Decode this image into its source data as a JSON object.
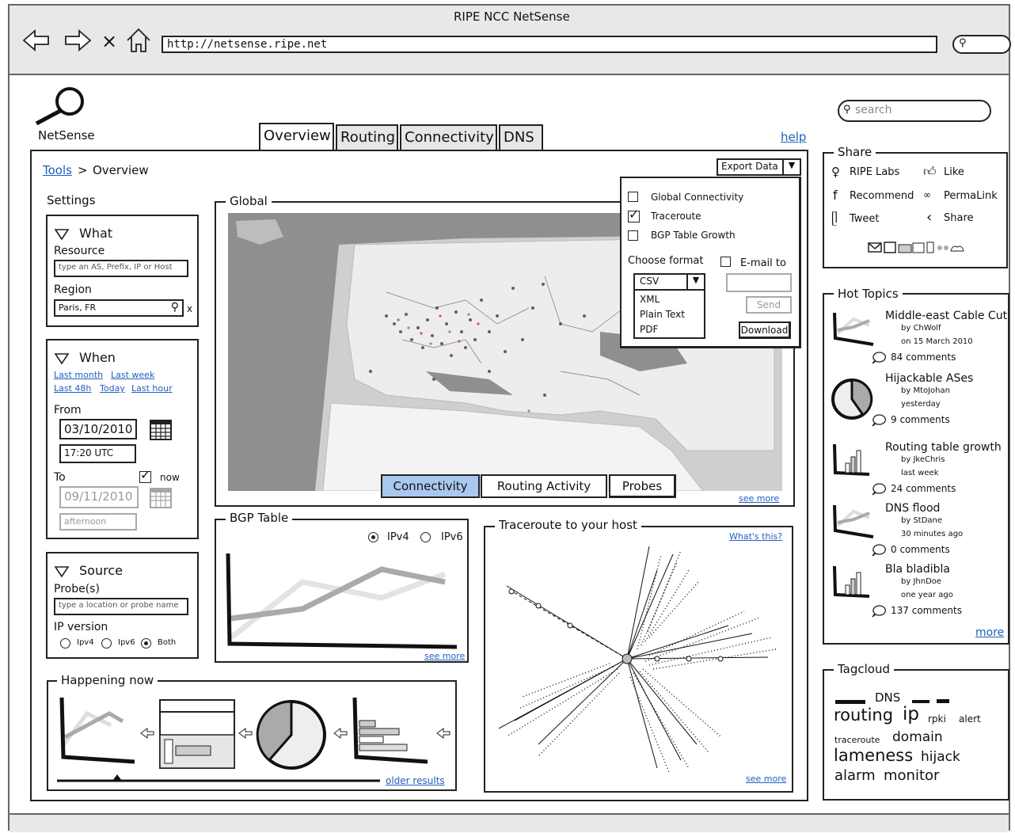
{
  "window": {
    "title": "RIPE NCC NetSense",
    "url": "http://netsense.ripe.net"
  },
  "logo": {
    "text": "NetSense"
  },
  "tabs": [
    "Overview",
    "Routing",
    "Connectivity",
    "DNS"
  ],
  "help_label": "help",
  "search": {
    "placeholder": "search"
  },
  "breadcrumb": {
    "tools": "Tools",
    "sep": ">",
    "current": "Overview"
  },
  "settings": {
    "title": "Settings",
    "what": {
      "title": "What",
      "resource_label": "Resource",
      "resource_placeholder": "type an AS, Prefix, IP or Host",
      "region_label": "Region",
      "region_value": "Paris, FR",
      "clear": "x"
    },
    "when": {
      "title": "When",
      "quick_links": [
        "Last month",
        "Last week",
        "Last 48h",
        "Today",
        "Last hour"
      ],
      "from_label": "From",
      "from_date": "03/10/2010",
      "from_time": "17:20 UTC",
      "to_label": "To",
      "now_label": "now",
      "to_date": "09/11/2010",
      "to_time": "afternoon"
    },
    "source": {
      "title": "Source",
      "probes_label": "Probe(s)",
      "probes_placeholder": "type a location or probe name",
      "ip_label": "IP version",
      "options": [
        "Ipv4",
        "Ipv6",
        "Both"
      ],
      "selected": "Both"
    }
  },
  "global": {
    "title": "Global",
    "map_tabs": [
      "Connectivity",
      "Routing Activity",
      "Probes"
    ],
    "see_more": "see more"
  },
  "export": {
    "button": "Export Data",
    "options": [
      {
        "label": "Global Connectivity",
        "checked": false
      },
      {
        "label": "Traceroute",
        "checked": true
      },
      {
        "label": "BGP Table Growth",
        "checked": false
      }
    ],
    "format_label": "Choose format",
    "format_selected": "CSV",
    "formats": [
      "XML",
      "Plain Text",
      "PDF"
    ],
    "email_label": "E-mail to",
    "send": "Send",
    "download": "Download"
  },
  "bgp": {
    "title": "BGP Table",
    "ipv4": "IPv4",
    "ipv6": "IPv6",
    "see_more": "see more"
  },
  "traceroute": {
    "title": "Traceroute to your host",
    "whats_this": "What's this?",
    "see_more": "see more"
  },
  "happening": {
    "title": "Happening now",
    "older": "older results"
  },
  "share": {
    "title": "Share",
    "items": [
      "RIPE Labs",
      "Like",
      "Recommend",
      "PermaLink",
      "Tweet",
      "Share"
    ]
  },
  "hot_topics": {
    "title": "Hot Topics",
    "items": [
      {
        "title": "Middle-east Cable Cut",
        "by": "by ChWolf",
        "when": "on 15 March 2010",
        "comments": "84 comments"
      },
      {
        "title": "Hijackable ASes",
        "by": "by MtoJohan",
        "when": "yesterday",
        "comments": "9 comments"
      },
      {
        "title": "Routing table growth",
        "by": "by JkeChris",
        "when": "last week",
        "comments": "24 comments"
      },
      {
        "title": "DNS flood",
        "by": "by StDane",
        "when": "30 minutes ago",
        "comments": "0 comments"
      },
      {
        "title": "Bla bladibla",
        "by": "by JhnDoe",
        "when": "one year ago",
        "comments": "137 comments"
      }
    ],
    "more": "more"
  },
  "tagcloud": {
    "title": "Tagcloud",
    "tags": [
      "DNS",
      "routing",
      "ip",
      "rpki",
      "alert",
      "traceroute",
      "domain",
      "lameness",
      "hijack",
      "alarm",
      "monitor"
    ]
  }
}
